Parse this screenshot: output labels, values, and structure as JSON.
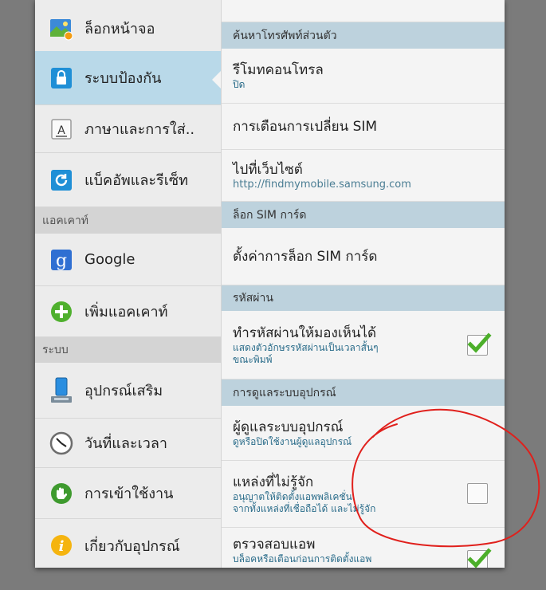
{
  "sidebar": {
    "items": [
      {
        "label": "ล็อกหน้าจอ",
        "icon": "lock-screen-icon"
      },
      {
        "label": "ระบบป้องกัน",
        "icon": "security-lock-icon",
        "active": true
      },
      {
        "label": "ภาษาและการใส่..",
        "icon": "language-keyboard-icon"
      },
      {
        "label": "แบ็คอัพและรีเซ็ท",
        "icon": "backup-reset-icon"
      },
      {
        "label": "Google",
        "icon": "google-icon"
      },
      {
        "label": "เพิ่มแอคเคาท์",
        "icon": "add-account-icon"
      },
      {
        "label": "อุปกรณ์เสริม",
        "icon": "accessory-icon"
      },
      {
        "label": "วันที่และเวลา",
        "icon": "clock-icon"
      },
      {
        "label": "การเข้าใช้งาน",
        "icon": "accessibility-icon"
      },
      {
        "label": "เกี่ยวกับอุปกรณ์",
        "icon": "info-icon"
      }
    ],
    "headers": {
      "accounts": "แอคเคาท์",
      "system": "ระบบ"
    }
  },
  "content": {
    "find_phone_header": "ค้นหาโทรศัพท์ส่วนตัว",
    "remote_controls": {
      "title": "รีโมทคอนโทรล",
      "sub": "ปิด"
    },
    "sim_change_alert": {
      "title": "การเตือนการเปลี่ยน SIM"
    },
    "go_to_website": {
      "title": "ไปที่เว็บไซต์",
      "sub": "http://findmymobile.samsung.com"
    },
    "sim_lock_header": "ล็อก SIM การ์ด",
    "sim_lock_setup": {
      "title": "ตั้งค่าการล็อก SIM การ์ด"
    },
    "password_header": "รหัสผ่าน",
    "make_password_visible": {
      "title": "ทำรหัสผ่านให้มองเห็นได้",
      "sub1": "แสดงตัวอักษรรหัสผ่านเป็นเวลาสั้นๆ",
      "sub2": "ขณะพิมพ์",
      "checked": true
    },
    "device_admin_header": "การดูแลระบบอุปกรณ์",
    "device_administrators": {
      "title": "ผู้ดูแลระบบอุปกรณ์",
      "sub": "ดูหรือปิดใช้งานผู้ดูแลอุปกรณ์"
    },
    "unknown_sources": {
      "title": "แหล่งที่ไม่รู้จัก",
      "sub1": "อนุญาตให้ติดตั้งแอพพลิเคชั่น",
      "sub2": "จากทั้งแหล่งที่เชื่อถือได้ และไม่รู้จัก",
      "checked": false
    },
    "verify_apps": {
      "title": "ตรวจสอบแอพ",
      "sub": "บล็อคหรือเตือนก่อนการติดตั้งแอพ",
      "checked": true
    }
  },
  "colors": {
    "accent_blue": "#b9d9e9",
    "section_header": "#bdd2dd",
    "check_green": "#4caf2a",
    "annotation_red": "#e0201c"
  }
}
